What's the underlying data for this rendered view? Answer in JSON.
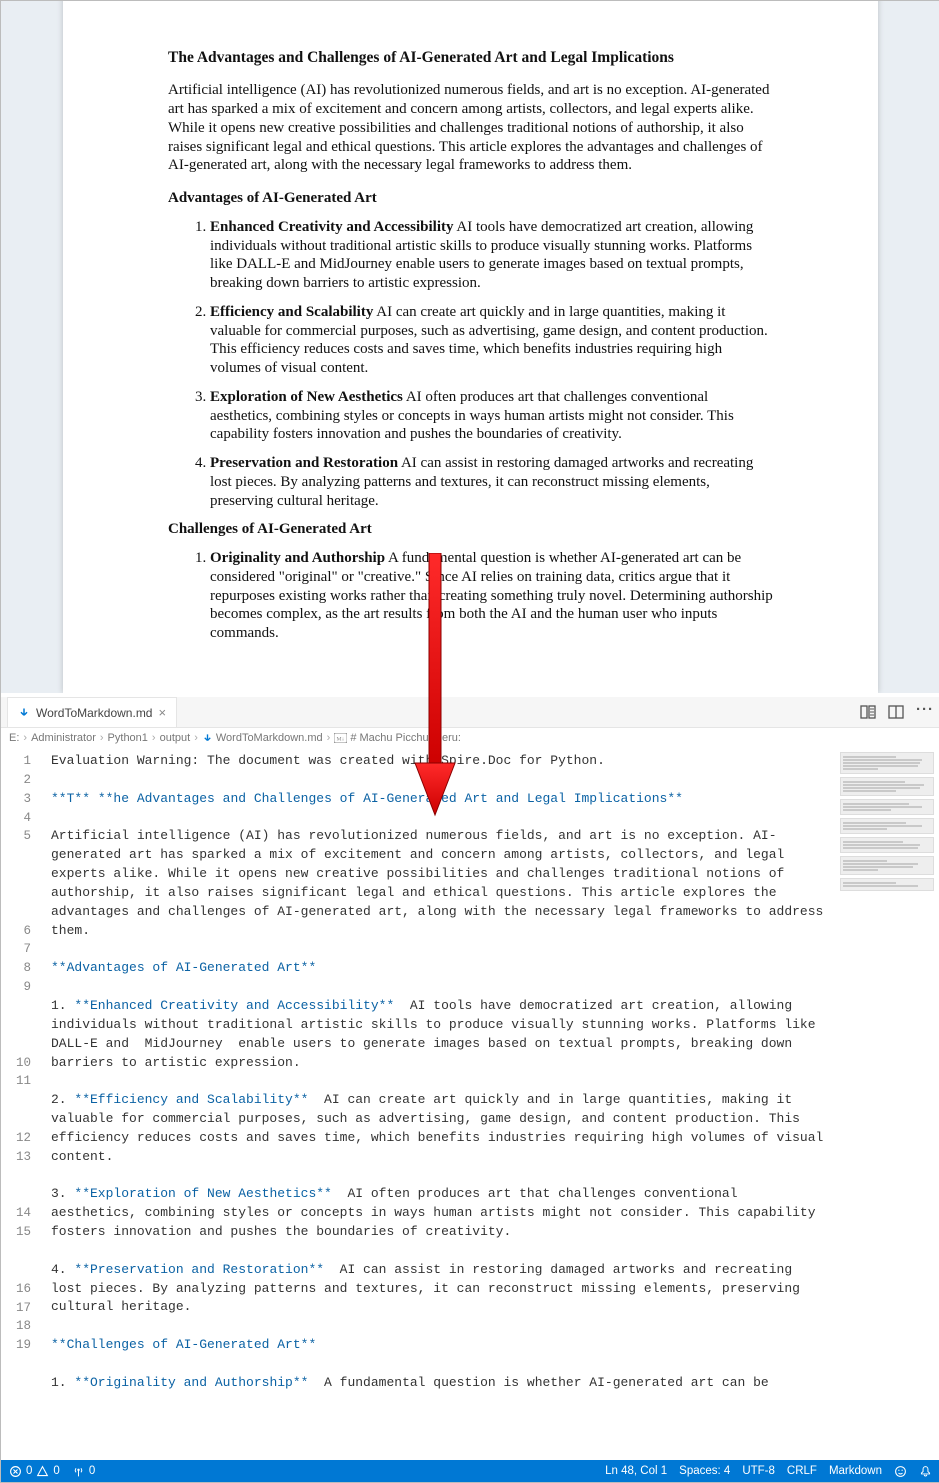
{
  "doc": {
    "title": "The Advantages and Challenges of AI-Generated Art and Legal Implications",
    "intro": "Artificial intelligence (AI) has revolutionized numerous fields, and art is no exception. AI-generated art has sparked a mix of excitement and concern among artists, collectors, and legal experts alike. While it opens new creative possibilities and challenges traditional notions of authorship, it also raises significant legal and ethical questions. This article explores the advantages and challenges of AI-generated art, along with the necessary legal frameworks to address them.",
    "h2_adv": "Advantages of AI-Generated Art",
    "adv": [
      {
        "lead": "Enhanced Creativity and Accessibility",
        "body": " AI tools have democratized art creation, allowing individuals without traditional artistic skills to produce visually stunning works. Platforms like DALL-E and MidJourney enable users to generate images based on textual prompts, breaking down barriers to artistic expression."
      },
      {
        "lead": "Efficiency and Scalability",
        "body": " AI can create art quickly and in large quantities, making it valuable for commercial purposes, such as advertising, game design, and content production. This efficiency reduces costs and saves time, which benefits industries requiring high volumes of visual content."
      },
      {
        "lead": "Exploration of New Aesthetics",
        "body": " AI often produces art that challenges conventional aesthetics, combining styles or concepts in ways human artists might not consider. This capability fosters innovation and pushes the boundaries of creativity."
      },
      {
        "lead": "Preservation and Restoration",
        "body": " AI can assist in restoring damaged artworks and recreating lost pieces. By analyzing patterns and textures, it can reconstruct missing elements, preserving cultural heritage."
      }
    ],
    "h2_ch": "Challenges of AI-Generated Art",
    "ch": [
      {
        "lead": "Originality and Authorship",
        "body": " A fundamental question is whether AI-generated art can be considered \"original\" or \"creative.\" Since AI relies on training data, critics argue that it repurposes existing works rather than creating something truly novel. Determining authorship becomes complex, as the art results from both the AI and the human user who inputs commands."
      }
    ]
  },
  "tab": {
    "name": "WordToMarkdown.md",
    "close": "×"
  },
  "toolbar_icons": {
    "compare": "compare-icon",
    "split": "split-icon",
    "more": "more-icon"
  },
  "breadcrumbs": {
    "parts": [
      "E:",
      "Administrator",
      "Python1",
      "output",
      "WordToMarkdown.md",
      "# Machu Picchu, Peru:"
    ],
    "file_icon": "markdown-file-icon",
    "md_icon": "heading-icon"
  },
  "code_lines": [
    {
      "n": "1",
      "text": "Evaluation Warning: The document was created with Spire.Doc for Python."
    },
    {
      "n": "2",
      "text": ""
    },
    {
      "n": "3",
      "text": "**T** **he Advantages and Challenges of AI-Generated Art and Legal Implications**",
      "hl": true
    },
    {
      "n": "4",
      "text": ""
    },
    {
      "n": "5",
      "text": "Artificial intelligence (AI) has revolutionized numerous fields, and art is no exception. AI-generated art has sparked a mix of excitement and concern among artists, collectors, and legal experts alike. While it opens new creative possibilities and challenges traditional notions of authorship, it also raises significant legal and ethical questions. This article explores the advantages and challenges of AI-generated art, along with the necessary legal frameworks to address them."
    },
    {
      "n": "6",
      "text": ""
    },
    {
      "n": "7",
      "text": "**Advantages of AI-Generated Art**",
      "hl": true
    },
    {
      "n": "8",
      "text": ""
    },
    {
      "n": "9",
      "text": "1. **Enhanced Creativity and Accessibility**  AI tools have democratized art creation, allowing individuals without traditional artistic skills to produce visually stunning works. Platforms like DALL-E and  MidJourney  enable users to generate images based on textual prompts, breaking down barriers to artistic expression.",
      "hl": true
    },
    {
      "n": "10",
      "text": ""
    },
    {
      "n": "11",
      "text": "2. **Efficiency and Scalability**  AI can create art quickly and in large quantities, making it valuable for commercial purposes, such as advertising, game design, and content production. This efficiency reduces costs and saves time, which benefits industries requiring high volumes of visual content.",
      "hl": true
    },
    {
      "n": "12",
      "text": ""
    },
    {
      "n": "13",
      "text": "3. **Exploration of New Aesthetics**  AI often produces art that challenges conventional aesthetics, combining styles or concepts in ways human artists might not consider. This capability fosters innovation and pushes the boundaries of creativity.",
      "hl": true
    },
    {
      "n": "14",
      "text": ""
    },
    {
      "n": "15",
      "text": "4. **Preservation and Restoration**  AI can assist in restoring damaged artworks and recreating lost pieces. By analyzing patterns and textures, it can reconstruct missing elements, preserving cultural heritage.",
      "hl": true
    },
    {
      "n": "16",
      "text": ""
    },
    {
      "n": "17",
      "text": "**Challenges of AI-Generated Art**",
      "hl": true
    },
    {
      "n": "18",
      "text": ""
    },
    {
      "n": "19",
      "text": "1. **Originality and Authorship**  A fundamental question is whether AI-generated art can be",
      "hl": true
    }
  ],
  "status": {
    "left": [
      {
        "icon": "errors-icon",
        "text": "0"
      },
      {
        "icon": "warnings-icon",
        "text": "0"
      },
      {
        "icon": "ports-icon",
        "text": "0"
      }
    ],
    "right": [
      {
        "text": "Ln 48, Col 1"
      },
      {
        "text": "Spaces: 4"
      },
      {
        "text": "UTF-8"
      },
      {
        "text": "CRLF"
      },
      {
        "text": "Markdown"
      },
      {
        "icon": "feedback-icon",
        "text": ""
      },
      {
        "icon": "bell-icon",
        "text": ""
      }
    ]
  }
}
